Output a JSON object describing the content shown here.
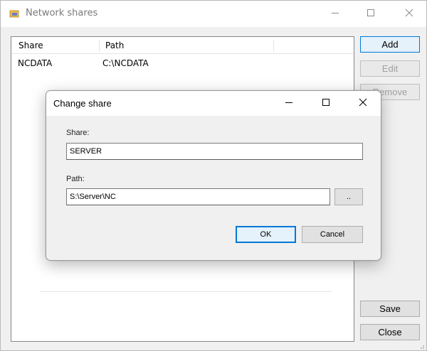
{
  "window": {
    "title": "Network shares",
    "icon": "folder-network-icon"
  },
  "grid": {
    "columns": [
      "Share",
      "Path",
      ""
    ],
    "rows": [
      {
        "share": "NCDATA",
        "path": "C:\\NCDATA"
      }
    ]
  },
  "side_buttons": {
    "add": "Add",
    "edit": "Edit",
    "remove": "Remove",
    "save": "Save",
    "close": "Close"
  },
  "dialog": {
    "title": "Change share",
    "share_label": "Share:",
    "share_value": "SERVER",
    "path_label": "Path:",
    "path_value": "S:\\Server\\NC",
    "browse_label": "..",
    "ok_label": "OK",
    "cancel_label": "Cancel"
  },
  "colors": {
    "accent": "#0078d7",
    "window_bg": "#f0f0f0",
    "disabled_text": "#a0a0a0"
  }
}
